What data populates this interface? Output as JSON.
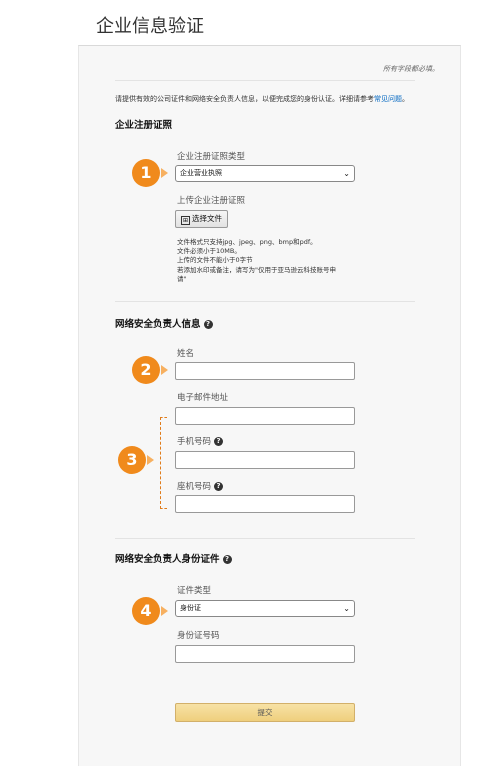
{
  "page": {
    "title": "企业信息验证"
  },
  "form": {
    "required_note": "所有字段都必填。",
    "intro_text": "请提供有效的公司证件和网络安全负责人信息，以便完成您的身份认证。详细请参考",
    "intro_link": "常见问题",
    "intro_end": "。",
    "sections": {
      "registration": {
        "title": "企业注册证照",
        "cert_type_label": "企业注册证照类型",
        "cert_type_value": "企业营业执照",
        "upload_label": "上传企业注册证照",
        "choose_file_label": "选择文件",
        "file_notes": [
          "文件格式只支持jpg、jpeg、png、bmp和pdf。",
          "文件必须小于10MB。",
          "上传的文件不能小于0字节",
          "若添加水印或备注，请写为\"仅用于亚马逊云科技账号申请\""
        ]
      },
      "security_contact": {
        "title": "网络安全负责人信息",
        "name_label": "姓名",
        "email_label": "电子邮件地址",
        "mobile_label": "手机号码",
        "landline_label": "座机号码"
      },
      "security_id": {
        "title": "网络安全负责人身份证件",
        "id_type_label": "证件类型",
        "id_type_value": "身份证",
        "id_number_label": "身份证号码"
      }
    },
    "submit_label": "提交"
  },
  "annotations": {
    "badges": [
      "1",
      "2",
      "3",
      "4"
    ],
    "badge_color": "#f08a1c"
  },
  "icons": {
    "help": "question-circle-icon",
    "select": "chevron-down-icon",
    "file": "upload-icon"
  }
}
